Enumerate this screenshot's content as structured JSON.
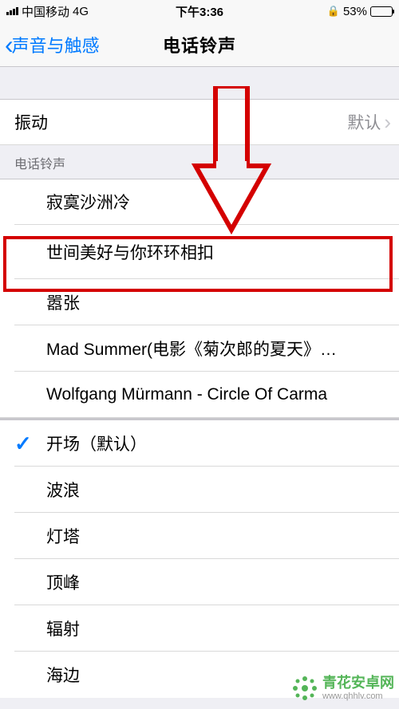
{
  "status": {
    "carrier": "中国移动",
    "network": "4G",
    "time": "下午3:36",
    "battery_pct": "53%"
  },
  "nav": {
    "back_label": "声音与触感",
    "title": "电话铃声"
  },
  "sections": {
    "vibration": {
      "label": "振动",
      "value": "默认"
    },
    "ringtone_header": "电话铃声",
    "custom_tones": [
      "寂寞沙洲冷",
      "世间美好与你环环相扣",
      "嚣张",
      "Mad Summer(电影《菊次郎的夏天》…",
      "Wolfgang Mürmann - Circle Of Carma"
    ],
    "builtin_tones": [
      "开场（默认）",
      "波浪",
      "灯塔",
      "顶峰",
      "辐射",
      "海边"
    ],
    "selected_builtin_index": 0
  },
  "watermark": {
    "brand": "青花安卓网",
    "url": "www.qhhlv.com"
  }
}
